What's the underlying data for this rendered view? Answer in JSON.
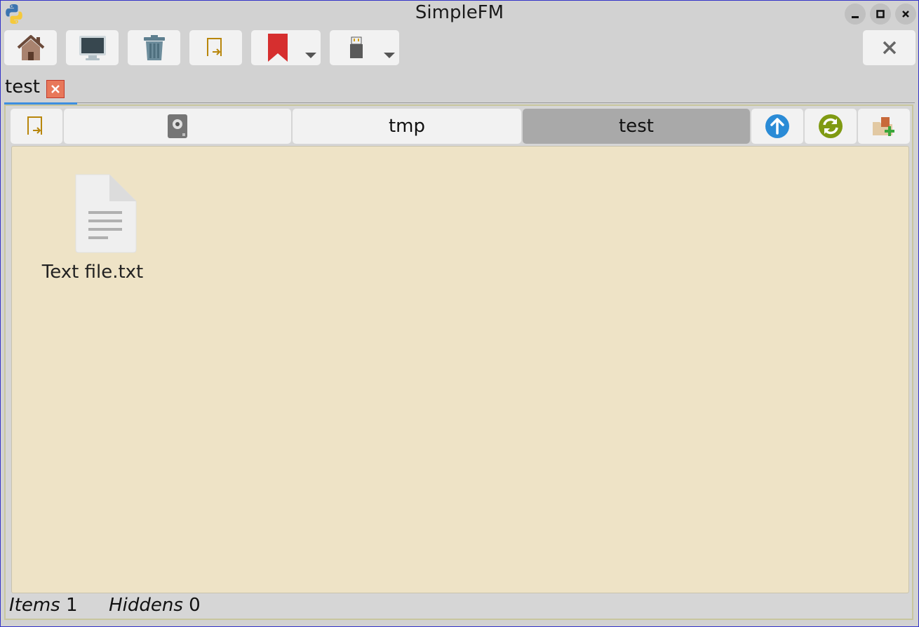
{
  "window": {
    "title": "SimpleFM",
    "controls": {
      "minimize": "_",
      "maximize": "▢",
      "close": "✕"
    }
  },
  "toolbar": {
    "buttons": [
      {
        "name": "home",
        "icon": "home-icon"
      },
      {
        "name": "computer",
        "icon": "monitor-icon"
      },
      {
        "name": "trash",
        "icon": "trash-icon"
      },
      {
        "name": "open-location",
        "icon": "folder-arrow-icon"
      },
      {
        "name": "bookmarks",
        "icon": "bookmark-icon",
        "dropdown": true
      },
      {
        "name": "media",
        "icon": "usb-drive-icon",
        "dropdown": true
      },
      {
        "name": "close",
        "icon": "close-icon"
      }
    ],
    "close_glyph": "✕"
  },
  "tabs": [
    {
      "label": "test",
      "active": true,
      "close_glyph": "✕"
    }
  ],
  "pathbar": {
    "segments": [
      {
        "label": "",
        "icon": "disk-icon"
      },
      {
        "label": "tmp"
      },
      {
        "label": "test",
        "active": true
      }
    ],
    "actions": [
      {
        "name": "go-up",
        "icon": "arrow-up-icon"
      },
      {
        "name": "refresh",
        "icon": "refresh-icon"
      },
      {
        "name": "new-folder",
        "icon": "new-folder-icon"
      }
    ]
  },
  "files": [
    {
      "name": "Text file.txt",
      "icon": "text-file-icon"
    }
  ],
  "status": {
    "items_label": "Items",
    "items_count": "1",
    "hidden_label": "Hiddens",
    "hidden_count": "0"
  },
  "colors": {
    "file_area_bg": "#eee3c6",
    "active_segment": "#a9a9a9",
    "tab_close": "#e8785a",
    "accent": "#3d8ee0"
  }
}
